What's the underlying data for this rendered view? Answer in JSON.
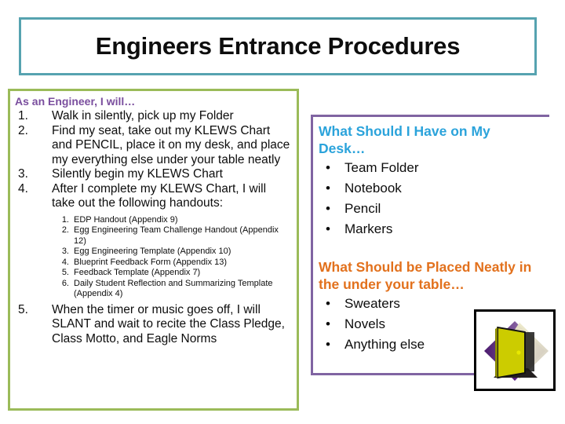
{
  "slide": {
    "title": "Engineers Entrance Procedures",
    "colors": {
      "title_border": "#56A3B0",
      "left_box_border": "#9BBB59",
      "right_box_border": "#8064A2",
      "left_heading": "#7A4E9E",
      "blue_heading": "#2BA3DB",
      "orange_heading": "#E2711D",
      "body_text": "#0D0D0D",
      "background": "#FFFFFF"
    }
  },
  "left_panel": {
    "heading": "As an Engineer, I will…",
    "steps": [
      {
        "num": "1.",
        "text": "Walk in silently, pick up my Folder"
      },
      {
        "num": "2.",
        "text": "Find my seat, take out my KLEWS Chart and PENCIL, place it on my desk, and place my everything else under your table neatly"
      },
      {
        "num": "3.",
        "text": "Silently begin my KLEWS Chart"
      },
      {
        "num": "4.",
        "text": "After I complete my KLEWS Chart, I will take out the following handouts:"
      }
    ],
    "handouts": [
      {
        "num": "1.",
        "text": "EDP Handout (Appendix 9)"
      },
      {
        "num": "2.",
        "text": "Egg Engineering Team Challenge Handout (Appendix 12)"
      },
      {
        "num": "3.",
        "text": "Egg Engineering Template (Appendix 10)"
      },
      {
        "num": "4.",
        "text": "Blueprint Feedback Form (Appendix 13)"
      },
      {
        "num": "5.",
        "text": "Feedback Template (Appendix 7)"
      },
      {
        "num": "6.",
        "text": "Daily Student Reflection and Summarizing Template (Appendix 4)"
      }
    ],
    "final_step": {
      "num": "5.",
      "text": "When the timer or music goes off, I will SLANT and wait to recite the Class Pledge, Class Motto, and Eagle Norms"
    }
  },
  "right_panel": {
    "desk_heading": "What Should I Have on My Desk…",
    "desk_items": [
      {
        "bullet": "•",
        "text": "Team Folder"
      },
      {
        "bullet": "•",
        "text": "Notebook"
      },
      {
        "bullet": "•",
        "text": "Pencil"
      },
      {
        "bullet": "•",
        "text": "Markers"
      }
    ],
    "under_table_heading": "What Should be Placed Neatly in the under your table…",
    "under_table_items": [
      {
        "bullet": "•",
        "text": "Sweaters"
      },
      {
        "bullet": "•",
        "text": "Novels"
      },
      {
        "bullet": "•",
        "text": "Anything else"
      }
    ],
    "image": {
      "name": "open-door-clipart",
      "door_color": "#CCCC00",
      "diamond_color": "#6B2C91",
      "frame_color": "#000000"
    }
  }
}
